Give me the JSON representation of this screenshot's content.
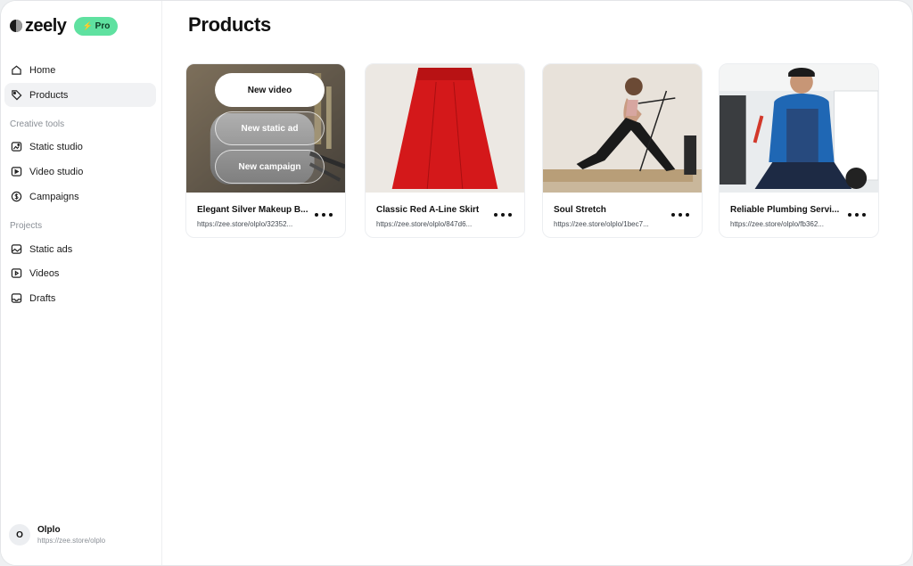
{
  "brand": {
    "name": "zeely",
    "badge": "Pro",
    "badge_icon": "⚡",
    "badge_color": "#5fe1a0"
  },
  "sidebar": {
    "main_items": [
      {
        "label": "Home",
        "icon": "home-icon"
      },
      {
        "label": "Products",
        "icon": "tag-icon",
        "active": true
      }
    ],
    "creative_label": "Creative tools",
    "creative_items": [
      {
        "label": "Static studio",
        "icon": "image-edit-icon"
      },
      {
        "label": "Video studio",
        "icon": "video-edit-icon"
      },
      {
        "label": "Campaigns",
        "icon": "dollar-circle-icon"
      }
    ],
    "projects_label": "Projects",
    "project_items": [
      {
        "label": "Static ads",
        "icon": "images-icon"
      },
      {
        "label": "Videos",
        "icon": "play-square-icon"
      },
      {
        "label": "Drafts",
        "icon": "inbox-icon"
      }
    ]
  },
  "profile": {
    "initial": "O",
    "name": "Olplo",
    "url": "https://zee.store/olplo"
  },
  "main": {
    "title": "Products",
    "hover_actions": {
      "new_video": "New video",
      "new_static_ad": "New static ad",
      "new_campaign": "New campaign"
    },
    "products": [
      {
        "title": "Elegant Silver Makeup B...",
        "url": "https://zee.store/olplo/32352..."
      },
      {
        "title": "Classic Red A-Line Skirt",
        "url": "https://zee.store/olplo/847d6..."
      },
      {
        "title": "Soul Stretch",
        "url": "https://zee.store/olplo/1bec7..."
      },
      {
        "title": "Reliable Plumbing Servi...",
        "url": "https://zee.store/olplo/fb362..."
      }
    ]
  }
}
